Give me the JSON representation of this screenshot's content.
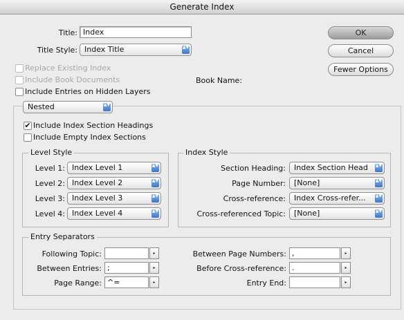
{
  "window": {
    "title": "Generate Index"
  },
  "title_field": {
    "label": "Title:",
    "value": "Index"
  },
  "title_style": {
    "label": "Title Style:",
    "value": "Index Title"
  },
  "options": {
    "replace_existing": "Replace Existing Index",
    "include_book_documents": "Include Book Documents",
    "include_hidden_layers": "Include Entries on Hidden Layers",
    "book_name_label": "Book Name:"
  },
  "buttons": {
    "ok": "OK",
    "cancel": "Cancel",
    "fewer_options": "Fewer Options"
  },
  "format_popup": {
    "value": "Nested"
  },
  "section_options": {
    "include_section_headings": "Include Index Section Headings",
    "include_empty_sections": "Include Empty Index Sections"
  },
  "level_style": {
    "title": "Level Style",
    "levels": [
      {
        "label": "Level 1:",
        "value": "Index Level 1"
      },
      {
        "label": "Level 2:",
        "value": "Index Level 2"
      },
      {
        "label": "Level 3:",
        "value": "Index Level 3"
      },
      {
        "label": "Level 4:",
        "value": "Index Level 4"
      }
    ]
  },
  "index_style": {
    "title": "Index Style",
    "rows": [
      {
        "label": "Section Heading:",
        "value": "Index Section Head"
      },
      {
        "label": "Page Number:",
        "value": "[None]"
      },
      {
        "label": "Cross-reference:",
        "value": "Index Cross-refer..."
      },
      {
        "label": "Cross-referenced Topic:",
        "value": "[None]"
      }
    ]
  },
  "entry_separators": {
    "title": "Entry Separators",
    "left": [
      {
        "label": "Following Topic:",
        "value": ""
      },
      {
        "label": "Between Entries:",
        "value": ";"
      },
      {
        "label": "Page Range:",
        "value": "^="
      }
    ],
    "right": [
      {
        "label": "Between Page Numbers:",
        "value": ","
      },
      {
        "label": "Before Cross-reference:",
        "value": "."
      },
      {
        "label": "Entry End:",
        "value": ""
      }
    ]
  },
  "glyphs": {
    "check": "✔",
    "popup_arrows": "▲▼",
    "right_arrow": "▸"
  }
}
